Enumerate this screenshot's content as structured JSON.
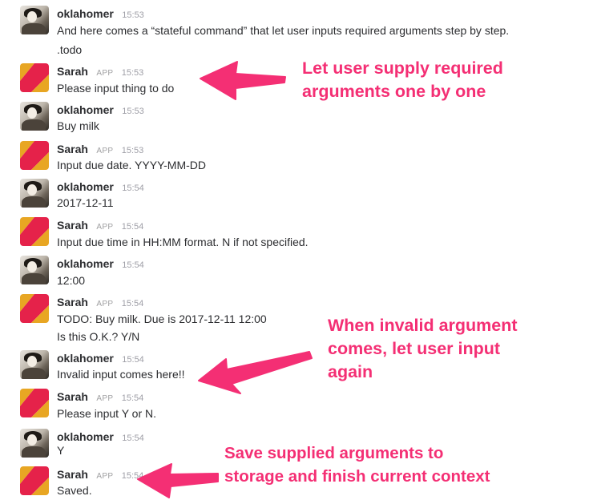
{
  "colors": {
    "annotation": "#f42f74",
    "text": "#2c2d30",
    "timestamp": "#9e9ea6"
  },
  "messages": [
    {
      "sender": "oklahomer",
      "time": "15:53",
      "lines": [
        "And here comes a “stateful command” that let user inputs required arguments step by step.",
        ".todo"
      ]
    },
    {
      "sender": "Sarah",
      "app": "APP",
      "time": "15:53",
      "lines": [
        "Please input thing to do"
      ]
    },
    {
      "sender": "oklahomer",
      "time": "15:53",
      "lines": [
        "Buy milk"
      ]
    },
    {
      "sender": "Sarah",
      "app": "APP",
      "time": "15:53",
      "lines": [
        "Input due date. YYYY-MM-DD"
      ]
    },
    {
      "sender": "oklahomer",
      "time": "15:54",
      "lines": [
        "2017-12-11"
      ]
    },
    {
      "sender": "Sarah",
      "app": "APP",
      "time": "15:54",
      "lines": [
        "Input due time in HH:MM format. N if not specified."
      ]
    },
    {
      "sender": "oklahomer",
      "time": "15:54",
      "lines": [
        "12:00"
      ]
    },
    {
      "sender": "Sarah",
      "app": "APP",
      "time": "15:54",
      "lines": [
        "TODO: Buy milk. Due is 2017-12-11 12:00",
        "Is this O.K.? Y/N"
      ]
    },
    {
      "sender": "oklahomer",
      "time": "15:54",
      "lines": [
        "Invalid input comes here!!"
      ]
    },
    {
      "sender": "Sarah",
      "app": "APP",
      "time": "15:54",
      "lines": [
        "Please input Y or N."
      ]
    },
    {
      "sender": "oklahomer",
      "time": "15:54",
      "lines": [
        "Y"
      ]
    },
    {
      "sender": "Sarah",
      "app": "APP",
      "time": "15:54",
      "lines": [
        "Saved."
      ]
    }
  ],
  "annotations": [
    {
      "lines": [
        "Let user supply required",
        "arguments one by one"
      ]
    },
    {
      "lines": [
        "When invalid argument",
        "comes, let user input",
        "again"
      ]
    },
    {
      "lines": [
        "Save supplied arguments to",
        "storage and finish current context"
      ]
    }
  ]
}
